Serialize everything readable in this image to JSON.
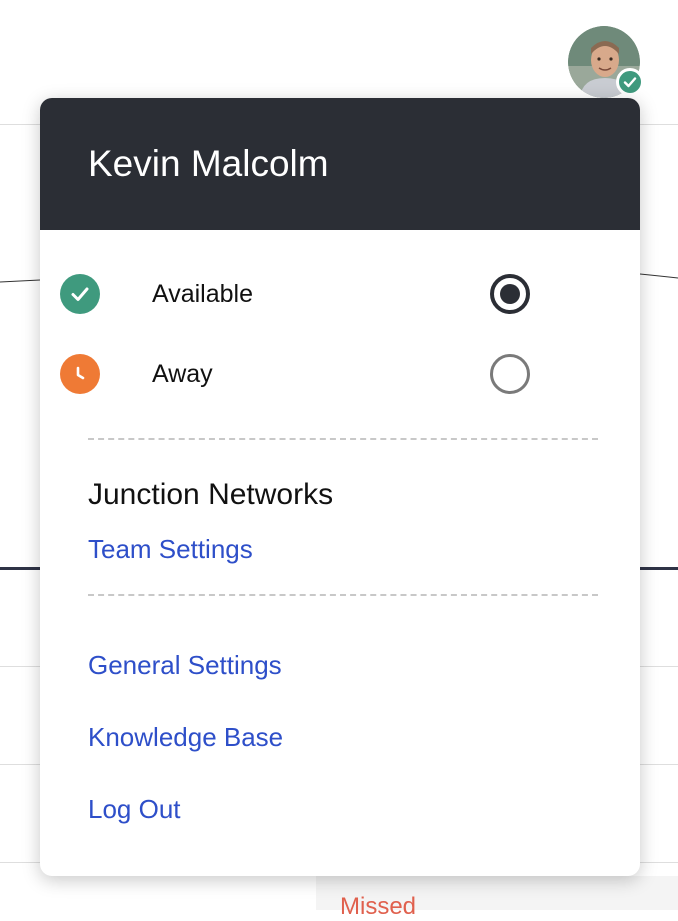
{
  "background": {
    "partial_label": "Missed"
  },
  "avatar": {
    "alt": "Kevin Malcolm avatar",
    "status_color": "#3f9a7e"
  },
  "menu": {
    "user_name": "Kevin Malcolm",
    "statuses": [
      {
        "label": "Available",
        "icon": "check-circle-icon",
        "color": "#3f9a7e",
        "selected": true
      },
      {
        "label": "Away",
        "icon": "clock-icon",
        "color": "#ef7a35",
        "selected": false
      }
    ],
    "team": {
      "name": "Junction Networks",
      "settings_link": "Team Settings"
    },
    "links": {
      "general_settings": "General Settings",
      "knowledge_base": "Knowledge Base",
      "log_out": "Log Out"
    }
  }
}
